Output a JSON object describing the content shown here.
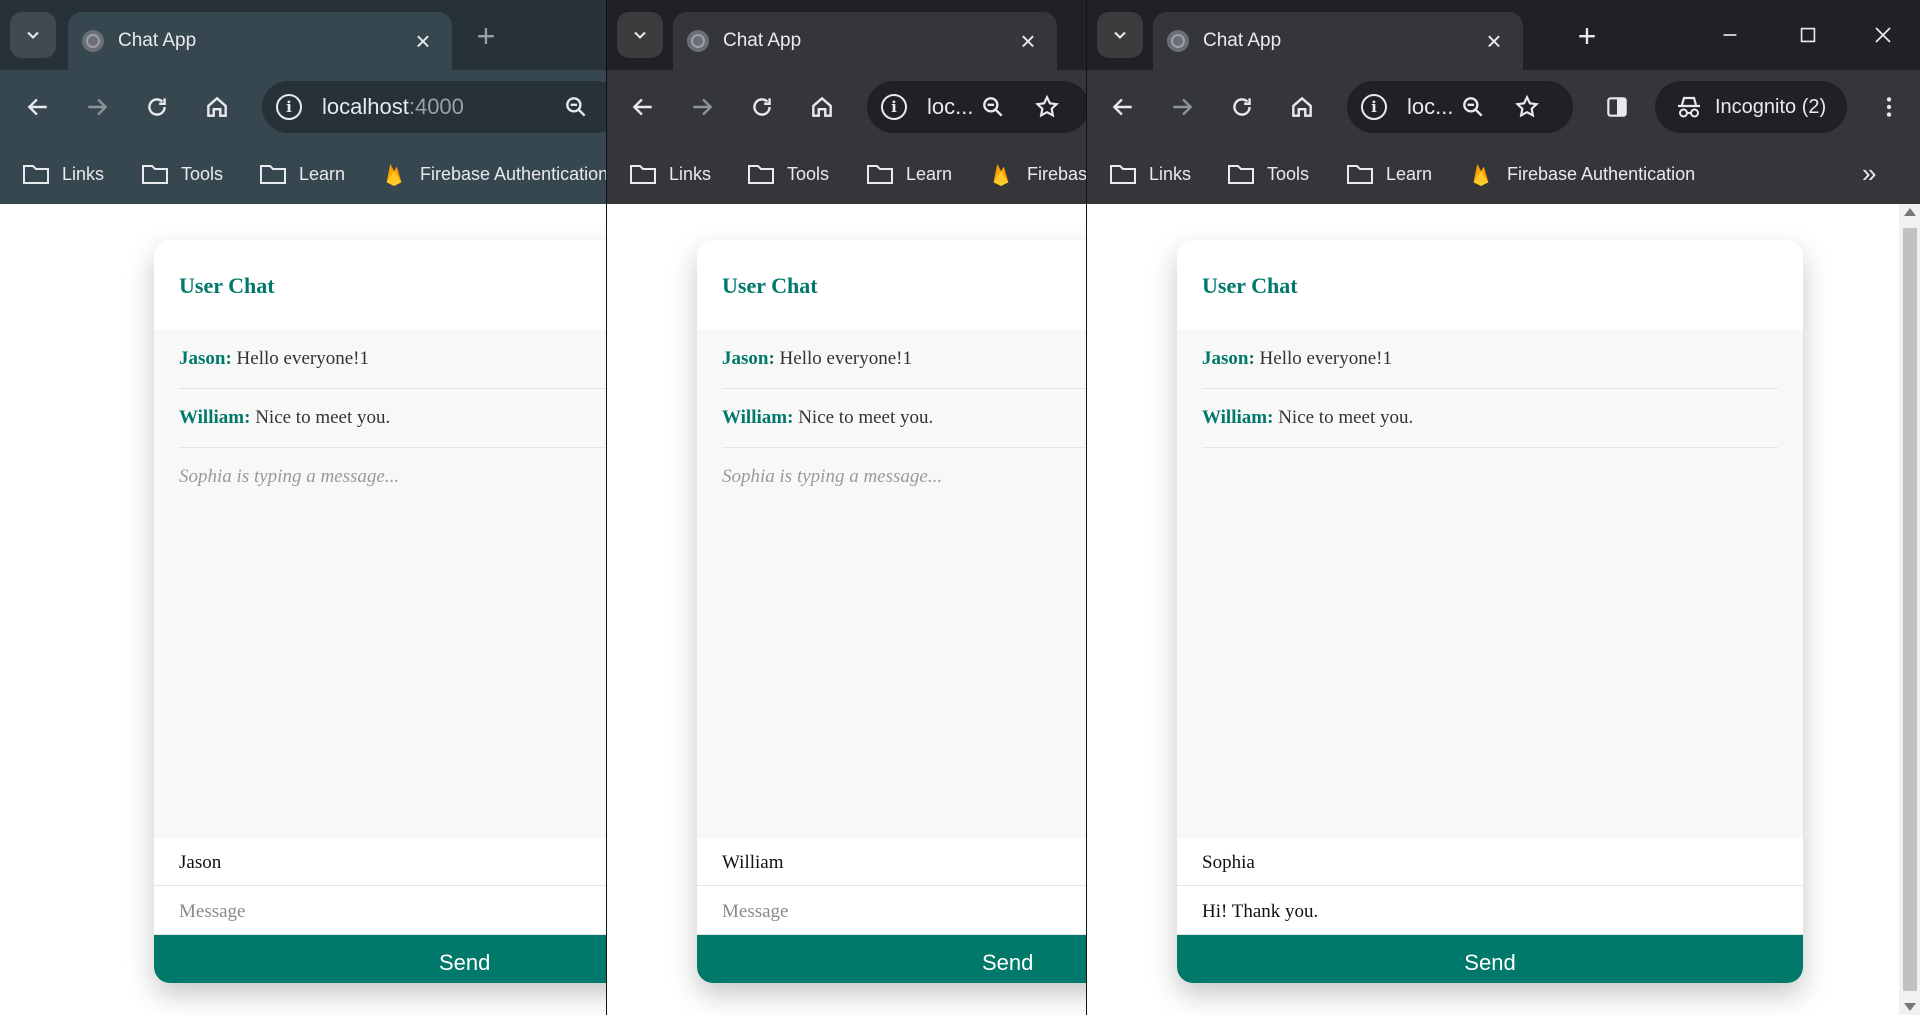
{
  "tab_title": "Chat App",
  "window1": {
    "url_host": "localhost",
    "url_port": ":4000",
    "bookmarks": [
      "Links",
      "Tools",
      "Learn",
      "Firebase Authentication"
    ],
    "chat": {
      "title": "User Chat",
      "messages": [
        {
          "author": "Jason:",
          "text": "Hello everyone!1"
        },
        {
          "author": "William:",
          "text": "Nice to meet you."
        }
      ],
      "typing": "Sophia is typing a message...",
      "name_value": "Jason",
      "message_placeholder": "Message",
      "send_label": "Send"
    }
  },
  "window2": {
    "url_short": "loc...",
    "bookmarks": [
      "Links",
      "Tools",
      "Learn",
      "Firebase"
    ],
    "chat": {
      "title": "User Chat",
      "messages": [
        {
          "author": "Jason:",
          "text": "Hello everyone!1"
        },
        {
          "author": "William:",
          "text": "Nice to meet you."
        }
      ],
      "typing": "Sophia is typing a message...",
      "name_value": "William",
      "message_placeholder": "Message",
      "send_label": "Send"
    }
  },
  "window3": {
    "url_short": "loc...",
    "incognito_label": "Incognito (2)",
    "bookmarks": [
      "Links",
      "Tools",
      "Learn",
      "Firebase Authentication"
    ],
    "bookmarks_overflow": "»",
    "chat": {
      "title": "User Chat",
      "messages": [
        {
          "author": "Jason:",
          "text": "Hello everyone!1"
        },
        {
          "author": "William:",
          "text": "Nice to meet you."
        }
      ],
      "name_value": "Sophia",
      "message_value": "Hi! Thank you.",
      "send_label": "Send"
    }
  },
  "icons": [
    "tab-menu-icon",
    "globe-icon",
    "close-icon",
    "new-tab-icon",
    "back-icon",
    "forward-icon",
    "reload-icon",
    "home-icon",
    "info-icon",
    "zoom-icon",
    "star-icon",
    "side-panel-icon",
    "incognito-icon",
    "more-icon",
    "folder-icon",
    "firebase-icon",
    "minimize-icon",
    "maximize-icon",
    "window-close-icon"
  ],
  "colors": {
    "accent": "#00796b",
    "chat_bg": "#f8f8f8",
    "chrome_dark": "#35363a",
    "chrome_theme": "#37474f"
  }
}
